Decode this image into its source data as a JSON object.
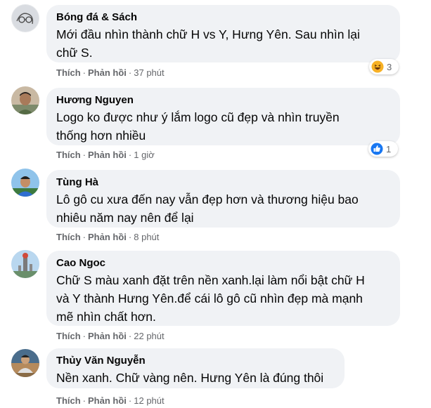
{
  "labels": {
    "like": "Thích",
    "reply": "Phản hồi",
    "dot": "·"
  },
  "comments": [
    {
      "author": "Bóng đá & Sách",
      "lines": [
        "Mới đầu nhìn thành chữ H vs Y, Hưng Yên. Sau nhìn lại",
        "chữ S."
      ],
      "time": "37 phút",
      "reaction": {
        "icon": "haha-icon",
        "count": "3"
      }
    },
    {
      "author": "Hương Nguyen",
      "lines": [
        "Logo ko được như ý lắm logo cũ đẹp và nhìn truyền",
        "thống hơn nhiều"
      ],
      "time": "1 giờ",
      "reaction": {
        "icon": "like-icon",
        "count": "1"
      }
    },
    {
      "author": "Tùng Hà",
      "lines": [
        "Lô gô cu xưa đến nay vẫn đẹp hơn và thương hiệu bao",
        "nhiêu năm nay nên để lại"
      ],
      "time": "8 phút"
    },
    {
      "author": "Cao Ngoc",
      "lines": [
        "Chữ S màu xanh đặt trên nền xanh.lại làm nổi bật chữ H",
        "và Y thành Hưng Yên.để cái lô gô cũ nhìn đẹp mà mạnh",
        "mẽ nhìn chất hơn."
      ],
      "time": "22 phút"
    },
    {
      "author": "Thủy Văn Nguyễn",
      "lines": [
        "Nền xanh. Chữ vàng nên. Hưng Yên là đúng thôi"
      ],
      "time": "12 phút"
    }
  ],
  "colors": {
    "bubble": "#f0f2f5",
    "meta": "#65676b",
    "like_blue": "#1877f2",
    "haha_yellow": "#f7b125"
  }
}
